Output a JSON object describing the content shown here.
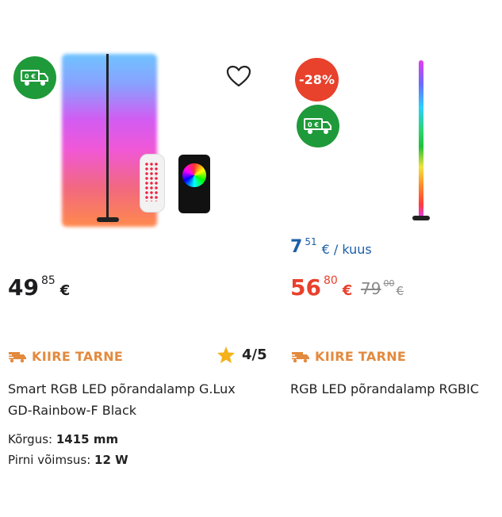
{
  "product1": {
    "delivery_badge": "0 €",
    "price_main": "49",
    "price_cents": "85",
    "price_currency": "€",
    "delivery_label": "KIIRE TARNE",
    "rating": "4/5",
    "title_line1": "Smart RGB LED põrandalamp G.Lux",
    "title_line2": "GD-Rainbow-F Black",
    "spec1_label": "Kõrgus:",
    "spec1_value": "1415 mm",
    "spec2_label": "Pirni võimsus:",
    "spec2_value": "12 W"
  },
  "product2": {
    "discount_badge": "-28%",
    "delivery_badge": "0 €",
    "monthly_main": "7",
    "monthly_cents": "51",
    "monthly_suffix": "€ / kuus",
    "price_main": "56",
    "price_cents": "80",
    "price_currency": "€",
    "old_price_main": "79",
    "old_price_cents": "00",
    "old_price_currency": "€",
    "delivery_label": "KIIRE TARNE",
    "title": "RGB LED põrandalamp RGBIC"
  },
  "colors": {
    "green_badge": "#1f9a3a",
    "red_badge": "#e8412c",
    "sale_price": "#e8412c",
    "monthly_price": "#1c5fa6",
    "delivery": "#e28a3e",
    "star": "#f3b21b"
  }
}
